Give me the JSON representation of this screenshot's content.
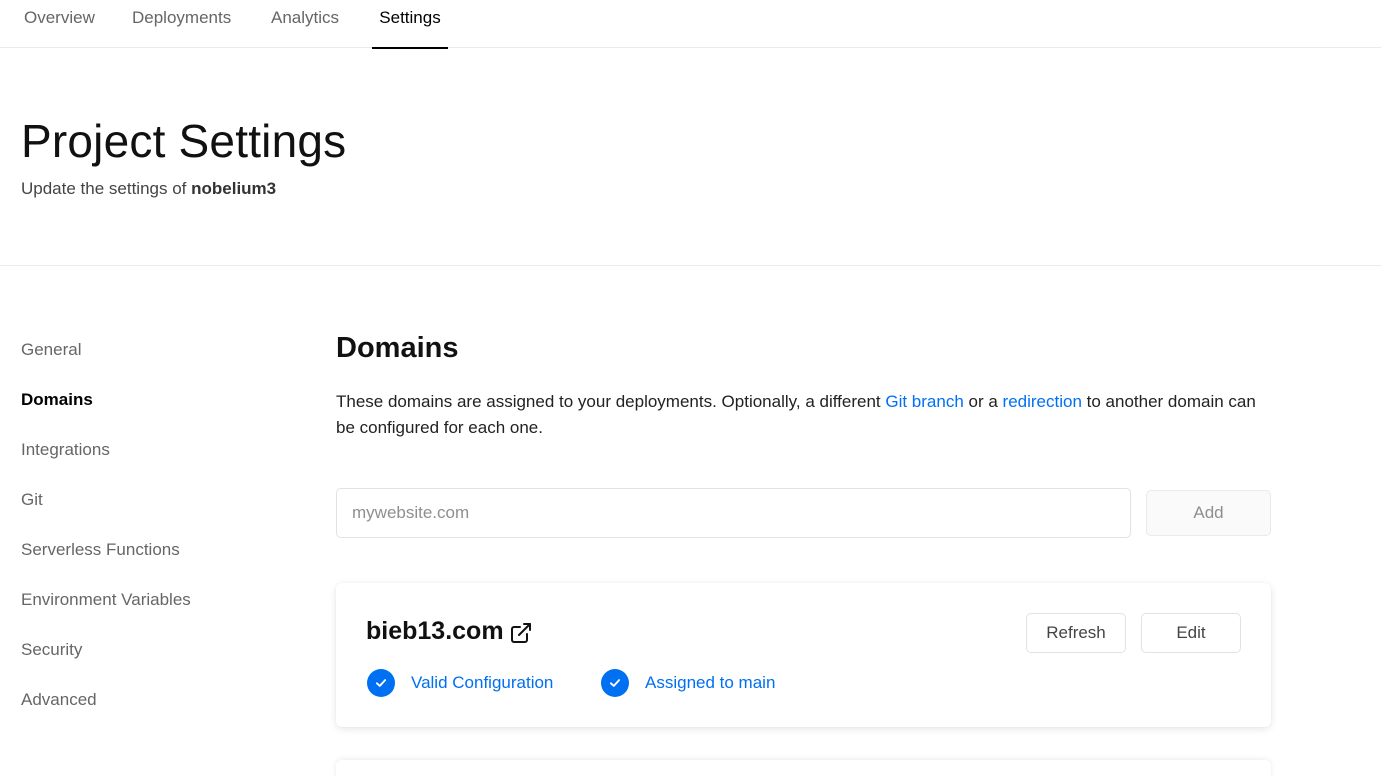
{
  "topnav": {
    "tabs": [
      {
        "label": "Overview"
      },
      {
        "label": "Deployments"
      },
      {
        "label": "Analytics"
      },
      {
        "label": "Settings",
        "active": true
      }
    ]
  },
  "header": {
    "title": "Project Settings",
    "subtitle_prefix": "Update the settings of ",
    "project_name": "nobelium3"
  },
  "sidebar": {
    "items": [
      {
        "label": "General"
      },
      {
        "label": "Domains",
        "active": true
      },
      {
        "label": "Integrations"
      },
      {
        "label": "Git"
      },
      {
        "label": "Serverless Functions"
      },
      {
        "label": "Environment Variables"
      },
      {
        "label": "Security"
      },
      {
        "label": "Advanced"
      }
    ]
  },
  "domains": {
    "title": "Domains",
    "desc_part1": "These domains are assigned to your deployments. Optionally, a different ",
    "desc_link1": "Git branch",
    "desc_part2": " or a ",
    "desc_link2": "redirection",
    "desc_part3": " to another domain can be configured for each one.",
    "input_placeholder": "mywebsite.com",
    "input_value": "",
    "add_label": "Add",
    "cards": [
      {
        "domain": "bieb13.com",
        "refresh_label": "Refresh",
        "edit_label": "Edit",
        "status1": "Valid Configuration",
        "status2": "Assigned to main"
      }
    ]
  },
  "colors": {
    "accent": "#0070f3",
    "muted": "#666666",
    "border": "#eaeaea"
  },
  "icons": [
    "external-link-icon",
    "check-circle-icon"
  ]
}
